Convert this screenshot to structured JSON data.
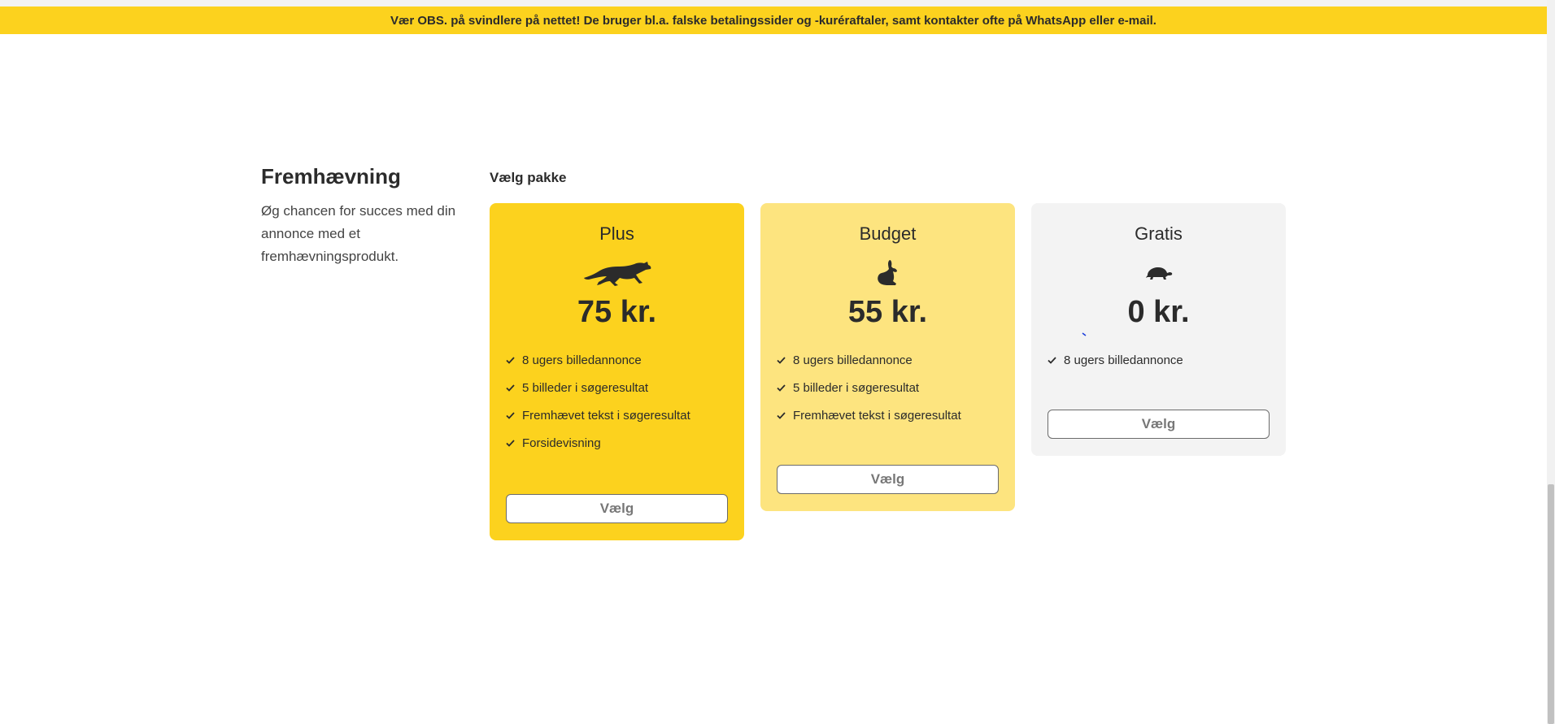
{
  "banner": {
    "text": "Vær OBS. på svindlere på nettet! De bruger bl.a. falske betalingssider og -kuréraftaler, samt kontakter ofte på WhatsApp eller e-mail.",
    "color": "#fcd21e"
  },
  "intro": {
    "title": "Fremhævning",
    "description": "Øg chancen for succes med din annonce med et fremhævningsprodukt."
  },
  "packages": {
    "label": "Vælg pakke",
    "plus": {
      "name": "Plus",
      "icon": "cheetah-icon",
      "price": "75 kr.",
      "color": "#fcd21e",
      "features": [
        "8 ugers billedannonce",
        "5 billeder i søgeresultat",
        "Fremhævet tekst i søgeresultat",
        "Forsidevisning"
      ],
      "button": "Vælg"
    },
    "budget": {
      "name": "Budget",
      "icon": "rabbit-icon",
      "price": "55 kr.",
      "color": "#fde47f",
      "features": [
        "8 ugers billedannonce",
        "5 billeder i søgeresultat",
        "Fremhævet tekst i søgeresultat"
      ],
      "button": "Vælg"
    },
    "gratis": {
      "name": "Gratis",
      "icon": "turtle-icon",
      "price": "0 kr.",
      "color": "#f3f3f3",
      "features": [
        "8 ugers billedannonce"
      ],
      "button": "Vælg"
    }
  }
}
